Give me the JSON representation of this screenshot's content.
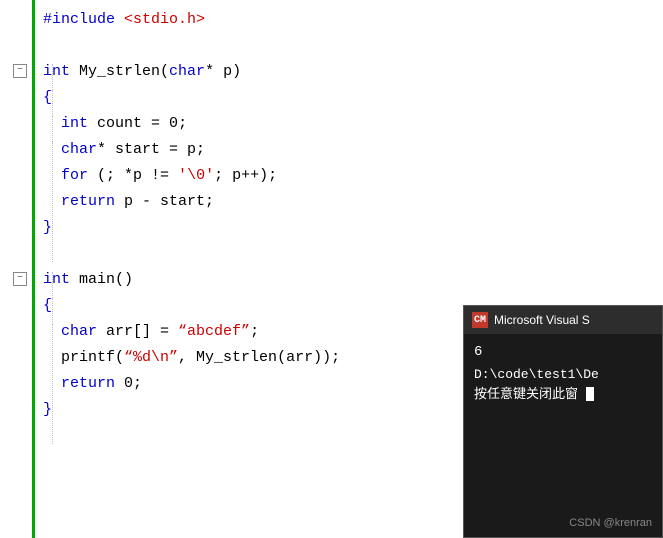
{
  "editor": {
    "lines": [
      {
        "id": "include",
        "indent": 0,
        "content": "#include <stdio.h>"
      },
      {
        "id": "blank1",
        "indent": 0,
        "content": ""
      },
      {
        "id": "func1-sig",
        "indent": 0,
        "fold": true,
        "content": "int My_strlen(char* p)"
      },
      {
        "id": "func1-open",
        "indent": 0,
        "content": "{"
      },
      {
        "id": "func1-l1",
        "indent": 1,
        "content": "int count = 0;"
      },
      {
        "id": "func1-l2",
        "indent": 1,
        "content": "char* start = p;"
      },
      {
        "id": "func1-l3",
        "indent": 1,
        "content": "for (; *p != '\\0'; p++);"
      },
      {
        "id": "func1-l4",
        "indent": 1,
        "content": "return p - start;"
      },
      {
        "id": "func1-close",
        "indent": 0,
        "content": "}"
      },
      {
        "id": "blank2",
        "indent": 0,
        "content": ""
      },
      {
        "id": "func2-sig",
        "indent": 0,
        "fold": true,
        "content": "int main()"
      },
      {
        "id": "func2-open",
        "indent": 0,
        "content": "{"
      },
      {
        "id": "func2-l1",
        "indent": 1,
        "content": "char arr[] = \"abcdef\";"
      },
      {
        "id": "func2-l2",
        "indent": 1,
        "content": "printf(\"%d\\n\", My_strlen(arr));"
      },
      {
        "id": "func2-l3",
        "indent": 1,
        "content": "return 0;"
      },
      {
        "id": "func2-close",
        "indent": 0,
        "content": "}"
      }
    ]
  },
  "terminal": {
    "title": "Microsoft Visual S",
    "icon_label": "CM",
    "output_number": "6",
    "path_text": "D:\\code\\test1\\De",
    "close_msg": "按任意键关闭此窗",
    "footer": "CSDN @krenran"
  },
  "colors": {
    "green_bar": "#00aa00",
    "keyword": "#0000cc",
    "string": "#cc0000",
    "plain": "#000000"
  }
}
